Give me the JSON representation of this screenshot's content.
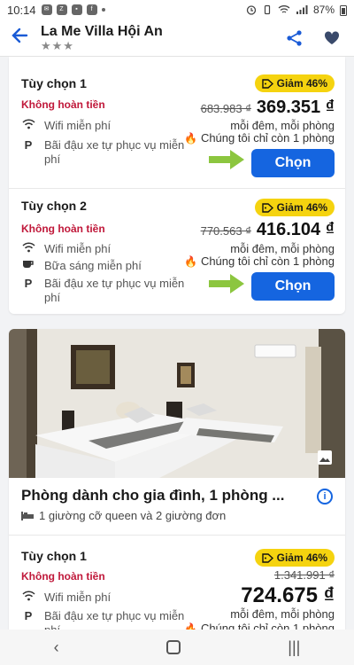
{
  "status": {
    "time": "10:14",
    "battery": "87%"
  },
  "header": {
    "hotel_name": "La Me Villa Hội An",
    "stars": "★★★"
  },
  "options": [
    {
      "title": "Tùy chọn 1",
      "discount": "Giảm 46%",
      "refund": "Không hoàn tiền",
      "features": [
        {
          "icon": "wifi-icon",
          "text": "Wifi miễn phí"
        },
        {
          "icon": "parking-icon",
          "text": "Bãi đậu xe tự phục vụ miễn phí"
        }
      ],
      "old_price": "683.983 ₫",
      "price": "369.351 ₫",
      "per_unit": "mỗi đêm, mỗi phòng",
      "availability": "Chúng tôi chỉ còn 1 phòng",
      "cta": "Chọn"
    },
    {
      "title": "Tùy chọn 2",
      "discount": "Giảm 46%",
      "refund": "Không hoàn tiền",
      "features": [
        {
          "icon": "wifi-icon",
          "text": "Wifi miễn phí"
        },
        {
          "icon": "coffee-icon",
          "text": "Bữa sáng miễn phí"
        },
        {
          "icon": "parking-icon",
          "text": "Bãi đậu xe tự phục vụ miễn phí"
        }
      ],
      "old_price": "770.563 ₫",
      "price": "416.104 ₫",
      "per_unit": "mỗi đêm, mỗi phòng",
      "availability": "Chúng tôi chỉ còn 1 phòng",
      "cta": "Chọn"
    }
  ],
  "room": {
    "title": "Phòng dành cho gia đình, 1 phòng ...",
    "beds": "1 giường cỡ queen và 2 giường đơn"
  },
  "room_option": {
    "title": "Tùy chọn 1",
    "discount": "Giảm 46%",
    "refund": "Không hoàn tiền",
    "features": [
      {
        "icon": "wifi-icon",
        "text": "Wifi miễn phí"
      },
      {
        "icon": "parking-icon",
        "text": "Bãi đậu xe tự phục vụ miễn phí"
      }
    ],
    "old_price": "1.341.991 ₫",
    "price": "724.675 ₫",
    "per_unit": "mỗi đêm, mỗi phòng",
    "availability": "Chúng tôi chỉ còn 1 phòng"
  },
  "colors": {
    "accent": "#1565e0",
    "badge": "#f5d30f",
    "nonrefundable": "#c0183a",
    "arrow": "#8cc63f"
  }
}
